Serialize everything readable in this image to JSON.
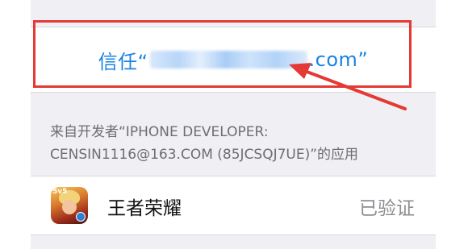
{
  "trust": {
    "prefix": "信任“",
    "suffix": ".com”"
  },
  "developer_note": {
    "line1": "来自开发者“IPHONE DEVELOPER:",
    "line2": "CENSIN1116@163.COM (85JCSQJ7UE)”的应用"
  },
  "app": {
    "name": "王者荣耀",
    "status": "已验证",
    "icon": "honor-of-kings-app-icon",
    "icon_badge": "5v5"
  },
  "colors": {
    "accent": "#1a82e2",
    "annotation": "#e53935",
    "secondary_text": "#6d6d72",
    "status_text": "#8e8e93"
  }
}
